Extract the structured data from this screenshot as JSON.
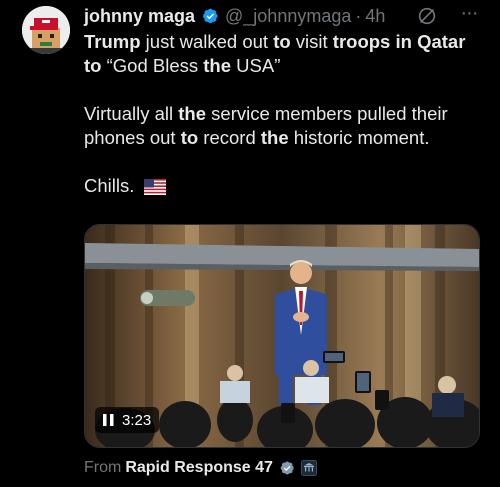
{
  "author": {
    "name": "johnny maga",
    "handle": "@_johnnymaga",
    "separator": "·",
    "time": "4h"
  },
  "post": {
    "line1": [
      {
        "t": "Trump",
        "b": true
      },
      {
        "t": " just walked out ",
        "b": false
      },
      {
        "t": "to",
        "b": true
      },
      {
        "t": " visit ",
        "b": false
      },
      {
        "t": "troops in Qatar",
        "b": true
      }
    ],
    "line2": [
      {
        "t": "to",
        "b": true
      },
      {
        "t": " “God Bless ",
        "b": false
      },
      {
        "t": "the",
        "b": true
      },
      {
        "t": " USA”",
        "b": false
      }
    ],
    "para2": [
      {
        "t": "Virtually all ",
        "b": false
      },
      {
        "t": "the",
        "b": true
      },
      {
        "t": " service members pulled their phones out ",
        "b": false
      },
      {
        "t": "to",
        "b": true
      },
      {
        "t": " record ",
        "b": false
      },
      {
        "t": "the",
        "b": true
      },
      {
        "t": " historic moment.",
        "b": false
      }
    ],
    "para3": "Chills."
  },
  "video": {
    "duration": "3:23",
    "state_icon": "pause-icon"
  },
  "source": {
    "label": "From",
    "name": "Rapid Response 47"
  },
  "colors": {
    "background": "#000000",
    "text": "#e7e9ea",
    "muted": "#71767b",
    "verified": "#1d9bf0"
  }
}
